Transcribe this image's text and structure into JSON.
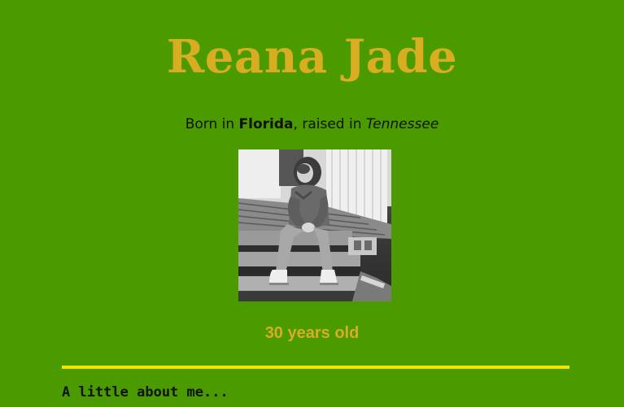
{
  "header": {
    "name": "Reana Jade"
  },
  "subtitle": {
    "prefix": "Born in ",
    "birth_place": "Florida",
    "middle": ", raised in ",
    "raised_place": "Tennessee"
  },
  "photo": {
    "alt": "Black and white photo of Reana Jade sitting on wooden steps"
  },
  "age": {
    "text": "30 years old"
  },
  "about": {
    "heading": "A little about me..."
  },
  "colors": {
    "background": "#4a9a00",
    "accent_gold": "#d8ad22",
    "divider_yellow": "#f3e500",
    "text": "#111111"
  }
}
